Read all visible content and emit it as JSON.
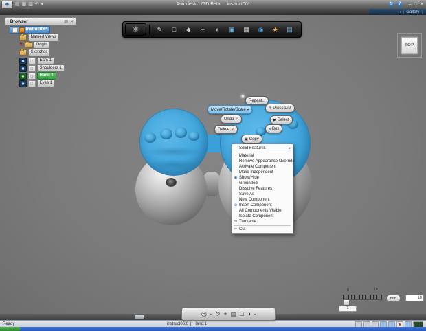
{
  "titlebar": {
    "app_title": "Autodesk 123D Beta",
    "doc_title": "instruct06*",
    "qat": [
      {
        "name": "app-menu"
      },
      {
        "name": "open"
      },
      {
        "name": "save"
      },
      {
        "name": "print"
      },
      {
        "name": "undo"
      },
      {
        "name": "redo-caret"
      }
    ],
    "right_icons": [
      {
        "name": "sync"
      },
      {
        "name": "help"
      }
    ],
    "controls": [
      {
        "name": "minimize"
      },
      {
        "name": "maximize"
      },
      {
        "name": "close"
      }
    ]
  },
  "menubar": {
    "gallery": "Gallery",
    "back_arrow": "◂",
    "separator": "|"
  },
  "browser": {
    "header": "Browser",
    "root": {
      "label": "instruct06*"
    },
    "items": [
      {
        "label": "Named Views",
        "kind": "folder",
        "selected": false
      },
      {
        "label": "Origin",
        "kind": "origin",
        "selected": false
      },
      {
        "label": "Sketches",
        "kind": "folder",
        "selected": false
      },
      {
        "label": "Ears 1",
        "kind": "component",
        "selected": false
      },
      {
        "label": "Shoulders 1",
        "kind": "component",
        "selected": false
      },
      {
        "label": "Hand 1",
        "kind": "component",
        "selected": true
      },
      {
        "label": "Eyes 1",
        "kind": "component",
        "selected": false
      }
    ]
  },
  "toolbar": {
    "icons": [
      {
        "name": "main-menu"
      },
      {
        "name": "sketch"
      },
      {
        "name": "primitives"
      },
      {
        "name": "press-pull"
      },
      {
        "name": "move"
      },
      {
        "name": "shell"
      },
      {
        "name": "combine"
      },
      {
        "name": "pattern"
      },
      {
        "name": "material"
      },
      {
        "name": "text-3d"
      },
      {
        "name": "snap-grid"
      }
    ]
  },
  "viewcube": {
    "label": "TOP"
  },
  "marking_menu": {
    "repeat": "Repeat...",
    "move": "Move/Rotate/Scale",
    "press_pull": "Press/Pull",
    "undo": "Undo",
    "select": "Select",
    "box": "Box",
    "delete": "Delete",
    "copy": "Copy"
  },
  "context_menu": {
    "items": [
      {
        "label": "Solid Features",
        "submenu": true
      },
      {
        "sep": true
      },
      {
        "label": "Material",
        "icon": "material"
      },
      {
        "label": "Remove Appearance Override"
      },
      {
        "label": "Activate Component"
      },
      {
        "label": "Make Independent"
      },
      {
        "label": "Show/Hide",
        "icon": "eye"
      },
      {
        "label": "Grounded"
      },
      {
        "label": "Dissolve Features"
      },
      {
        "label": "Save As"
      },
      {
        "label": "New Component"
      },
      {
        "label": "Insert Component",
        "icon": "insert"
      },
      {
        "label": "All Components Visible"
      },
      {
        "label": "Isolate Component"
      },
      {
        "label": "Turntable",
        "icon": "turntable"
      },
      {
        "sep": true
      },
      {
        "label": "Cut",
        "icon": "cut"
      }
    ]
  },
  "ruler": {
    "min_label": "0",
    "max_label": "10",
    "unit": "mm",
    "value": "10",
    "snap": "1"
  },
  "nav_toolbar": {
    "icons": [
      {
        "name": "steering-wheel"
      },
      {
        "name": "orbit"
      },
      {
        "name": "pan"
      },
      {
        "name": "look-at"
      },
      {
        "name": "view-box"
      },
      {
        "name": "display-style"
      }
    ]
  },
  "statusbar": {
    "left": "Ready",
    "doc": "instruct06:0",
    "separator": "|",
    "component": "Hand:1",
    "toggles": [
      {
        "name": "toggle-1",
        "color": "#c9ced6"
      },
      {
        "name": "toggle-2",
        "color": "#c9ced6"
      },
      {
        "name": "toggle-3",
        "color": "#c9ced6"
      },
      {
        "name": "snap-toggle",
        "color": "#9fc2e8"
      },
      {
        "name": "grid-toggle",
        "color": "#9fc2e8"
      },
      {
        "name": "record-toggle",
        "color": "#e8e8e8",
        "dot": "#c03030"
      },
      {
        "name": "ortho-toggle",
        "color": "#9fc2e8"
      },
      {
        "name": "display-toggle",
        "color": "#274a27"
      }
    ]
  },
  "colors": {
    "selection_blue": "#3fa5dd",
    "component_green": "#3fae49",
    "gallery_bar": "#1c3d5f",
    "taskbar_blue": "#2f63cc",
    "start_green": "#3c9e3c"
  }
}
